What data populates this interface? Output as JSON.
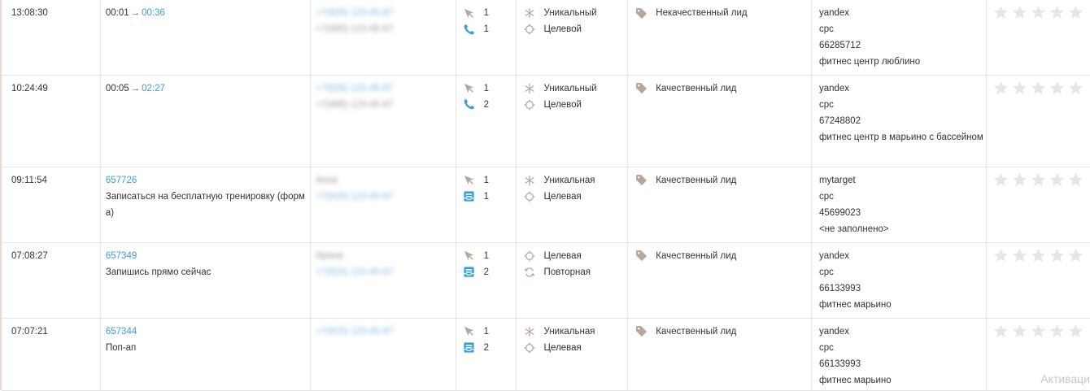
{
  "rows": [
    {
      "time": "13:08:30",
      "dur_start": "00:01",
      "dur_end": "00:36",
      "form_id": "",
      "form_title": "",
      "contact_name": "",
      "contact_phone": "+7(925) 123-45-67",
      "contact_phone2": "+7(495) 123-45-67",
      "activities": [
        {
          "icon": "cursor-icon",
          "count": "1"
        },
        {
          "icon": "phone-icon",
          "count": "1"
        }
      ],
      "types": [
        {
          "icon": "asterisk-icon",
          "label": "Уникальный"
        },
        {
          "icon": "target-icon",
          "label": "Целевой"
        }
      ],
      "tag": "Некачественный лид",
      "source": [
        "yandex",
        "cpc",
        "66285712",
        "фитнес центр люблино"
      ]
    },
    {
      "time": "10:24:49",
      "dur_start": "00:05",
      "dur_end": "02:27",
      "form_id": "",
      "form_title": "",
      "contact_name": "",
      "contact_phone": "+7(926) 123-45-67",
      "contact_phone2": "+7(495) 123-45-67",
      "activities": [
        {
          "icon": "cursor-icon",
          "count": "1"
        },
        {
          "icon": "phone-icon",
          "count": "2"
        }
      ],
      "types": [
        {
          "icon": "asterisk-icon",
          "label": "Уникальный"
        },
        {
          "icon": "target-icon",
          "label": "Целевой"
        }
      ],
      "tag": "Качественный лид",
      "source": [
        "yandex",
        "cpc",
        "67248802",
        "фитнес центр в марьино с бассейном"
      ]
    },
    {
      "time": "09:11:54",
      "dur_start": "",
      "dur_end": "",
      "form_id": "657726",
      "form_title": "Записаться на бесплатную тренировку (форм а)",
      "contact_name": "Анна",
      "contact_phone": "+7(916) 123-45-67",
      "contact_phone2": "",
      "activities": [
        {
          "icon": "cursor-icon",
          "count": "1"
        },
        {
          "icon": "form-icon",
          "count": "1"
        }
      ],
      "types": [
        {
          "icon": "asterisk-icon",
          "label": "Уникальная"
        },
        {
          "icon": "target-icon",
          "label": "Целевая"
        }
      ],
      "tag": "Качественный лид",
      "source": [
        "mytarget",
        "cpc",
        "45699023",
        "<не заполнено>"
      ]
    },
    {
      "time": "07:08:27",
      "dur_start": "",
      "dur_end": "",
      "form_id": "657349",
      "form_title": "Запишись прямо сейчас",
      "contact_name": "Ирина",
      "contact_phone": "+7(915) 123-45-67",
      "contact_phone2": "",
      "activities": [
        {
          "icon": "cursor-icon",
          "count": "1"
        },
        {
          "icon": "form-icon",
          "count": "2"
        }
      ],
      "types": [
        {
          "icon": "target-icon",
          "label": "Целевая"
        },
        {
          "icon": "repeat-icon",
          "label": "Повторная"
        }
      ],
      "tag": "Качественный лид",
      "source": [
        "yandex",
        "cpc",
        "66133993",
        "фитнес марьино"
      ]
    },
    {
      "time": "07:07:21",
      "dur_start": "",
      "dur_end": "",
      "form_id": "657344",
      "form_title": "Поп-ап",
      "contact_name": "",
      "contact_phone": "+7(915) 123-45-67",
      "contact_phone2": "",
      "activities": [
        {
          "icon": "cursor-icon",
          "count": "1"
        },
        {
          "icon": "form-icon",
          "count": "2"
        }
      ],
      "types": [
        {
          "icon": "asterisk-icon",
          "label": "Уникальная"
        },
        {
          "icon": "target-icon",
          "label": "Целевая"
        }
      ],
      "tag": "Качественный лид",
      "source": [
        "yandex",
        "cpc",
        "66133993",
        "фитнес марьино"
      ]
    }
  ],
  "rating_max": 5,
  "watermark": "Активаци",
  "colors": {
    "link": "#3a9fd8",
    "icon_gray": "#b9a69a",
    "icon_blue": "#3a9fd8",
    "star": "#e6e6e6"
  }
}
